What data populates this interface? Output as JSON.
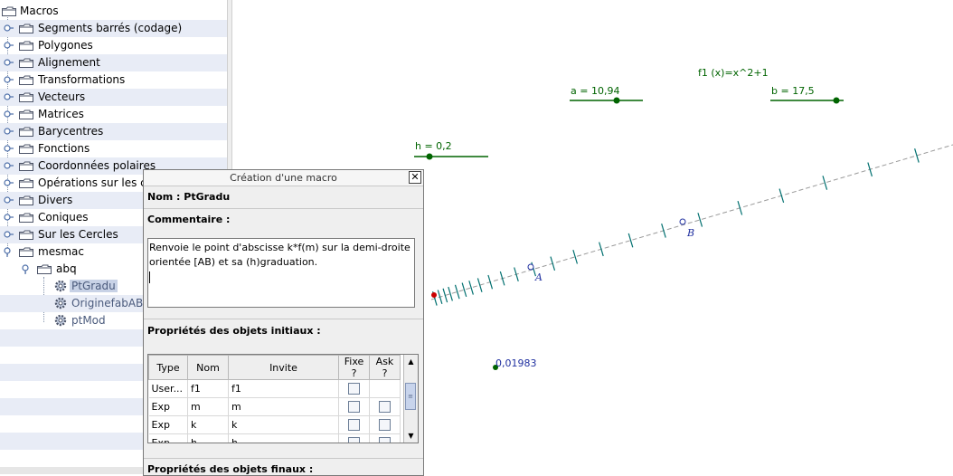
{
  "tree": {
    "root": "Macros",
    "folders": [
      "Segments barrés (codage)",
      "Polygones",
      "Alignement",
      "Transformations",
      "Vecteurs",
      "Matrices",
      "Barycentres",
      "Fonctions",
      "Coordonnées polaires",
      "Opérations sur les co",
      "Divers",
      "Coniques",
      "Sur les Cercles",
      "mesmac"
    ],
    "subfolder": "abq",
    "macros": [
      "PtGradu",
      "OriginefabAB",
      "ptMod"
    ],
    "selected_macro": "PtGradu"
  },
  "canvas": {
    "function_label": "f1 (x)=x^2+1",
    "slider_a": "a = 10,94",
    "slider_b": "b = 17,5",
    "slider_h": "h = 0,2",
    "point_A": "A",
    "point_B": "B",
    "value_label": "0,01983",
    "colors": {
      "object": "#006400",
      "ticks": "#007070",
      "point_red": "#cc0000",
      "point_blue": "#2030a0"
    }
  },
  "dialog": {
    "title": "Création d'une macro",
    "close_symbol": "✕",
    "name_label": "Nom : PtGradu",
    "comment_label": "Commentaire :",
    "comment_line1": "Renvoie le point d'abscisse k*f(m) sur la demi-droite",
    "comment_line2": "orientée [AB) et sa (h)graduation.",
    "initial_props_label": "Propriétés des objets initiaux :",
    "final_props_label": "Propriétés des objets finaux :",
    "table": {
      "headers": [
        "Type",
        "Nom",
        "Invite",
        "Fixe ?",
        "Ask ?"
      ],
      "rows": [
        {
          "type": "User...",
          "nom": "f1",
          "invite": "f1",
          "ask": false
        },
        {
          "type": "Exp",
          "nom": "m",
          "invite": "m",
          "ask": true
        },
        {
          "type": "Exp",
          "nom": "k",
          "invite": "k",
          "ask": true
        },
        {
          "type": "Exp",
          "nom": "h",
          "invite": "h",
          "ask": true
        }
      ]
    }
  }
}
